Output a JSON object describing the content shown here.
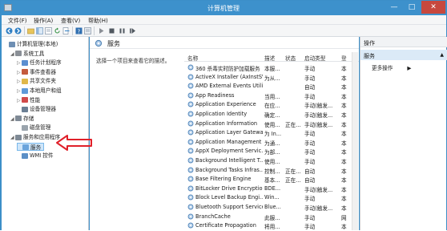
{
  "window": {
    "title": "计算机管理",
    "minimize": "—",
    "maximize": "□",
    "close": "✕"
  },
  "menu": [
    "文件(F)",
    "操作(A)",
    "查看(V)",
    "帮助(H)"
  ],
  "tree": [
    {
      "label": "计算机管理(本地)",
      "icon": "computer-icon",
      "level": 0,
      "arrow": ""
    },
    {
      "label": "系统工具",
      "icon": "tools-icon",
      "level": 1,
      "arrow": "◢"
    },
    {
      "label": "任务计划程序",
      "icon": "clock-icon",
      "level": 2,
      "arrow": "▷"
    },
    {
      "label": "事件查看器",
      "icon": "event-viewer-icon",
      "level": 2,
      "arrow": "▷"
    },
    {
      "label": "共享文件夹",
      "icon": "shared-folder-icon",
      "level": 2,
      "arrow": "▷"
    },
    {
      "label": "本地用户和组",
      "icon": "users-icon",
      "level": 2,
      "arrow": "▷"
    },
    {
      "label": "性能",
      "icon": "performance-icon",
      "level": 2,
      "arrow": "▷"
    },
    {
      "label": "设备管理器",
      "icon": "device-manager-icon",
      "level": 2,
      "arrow": ""
    },
    {
      "label": "存储",
      "icon": "storage-icon",
      "level": 1,
      "arrow": "◢"
    },
    {
      "label": "磁盘管理",
      "icon": "disk-icon",
      "level": 2,
      "arrow": ""
    },
    {
      "label": "服务和应用程序",
      "icon": "services-apps-icon",
      "level": 1,
      "arrow": "◢"
    },
    {
      "label": "服务",
      "icon": "services-icon",
      "level": 2,
      "arrow": "",
      "selected": true
    },
    {
      "label": "WMI 控件",
      "icon": "wmi-icon",
      "level": 2,
      "arrow": ""
    }
  ],
  "center": {
    "heading": "服务",
    "hint": "选择一个项目来查看它的描述。",
    "columns": [
      "名称",
      "描述",
      "状态",
      "启动类型",
      "登"
    ],
    "rows": [
      [
        "360 杀毒实时防护加载服务",
        "本服...",
        "",
        "手动",
        "本"
      ],
      [
        "ActiveX Installer (AxInstSV)",
        "为从...",
        "",
        "手动",
        "本"
      ],
      [
        "AMD External Events Utility",
        "",
        "",
        "自动",
        "本"
      ],
      [
        "App Readiness",
        "当用...",
        "",
        "手动",
        "本"
      ],
      [
        "Application Experience",
        "在应...",
        "",
        "手动(触发...",
        "本"
      ],
      [
        "Application Identity",
        "确定...",
        "",
        "手动(触发...",
        "本"
      ],
      [
        "Application Information",
        "使用...",
        "正在...",
        "手动(触发...",
        "本"
      ],
      [
        "Application Layer Gatewa...",
        "为 In...",
        "",
        "手动",
        "本"
      ],
      [
        "Application Management",
        "为通...",
        "",
        "手动",
        "本"
      ],
      [
        "AppX Deployment Servic...",
        "为部...",
        "",
        "手动",
        "本"
      ],
      [
        "Background Intelligent T...",
        "使用...",
        "",
        "手动",
        "本"
      ],
      [
        "Background Tasks Infras...",
        "控制...",
        "正在...",
        "自动",
        "本"
      ],
      [
        "Base Filtering Engine",
        "基本...",
        "正在...",
        "自动",
        "本"
      ],
      [
        "BitLocker Drive Encryptio...",
        "BDE...",
        "",
        "手动(触发...",
        "本"
      ],
      [
        "Block Level Backup Engi...",
        "Win...",
        "",
        "手动",
        "本"
      ],
      [
        "Bluetooth Support Service",
        "Blue...",
        "",
        "手动(触发...",
        "本"
      ],
      [
        "BranchCache",
        "此服...",
        "",
        "手动",
        "网"
      ],
      [
        "Certificate Propagation",
        "将用...",
        "",
        "手动",
        "本"
      ]
    ]
  },
  "actions": {
    "header": "操作",
    "section": "服务",
    "collapse": "▲",
    "more": "更多操作",
    "more_arrow": "▶"
  },
  "colors": {
    "titlebar": "#3d91cc",
    "selection": "#cfe6fa",
    "annotation_arrow": "#e0202a"
  }
}
